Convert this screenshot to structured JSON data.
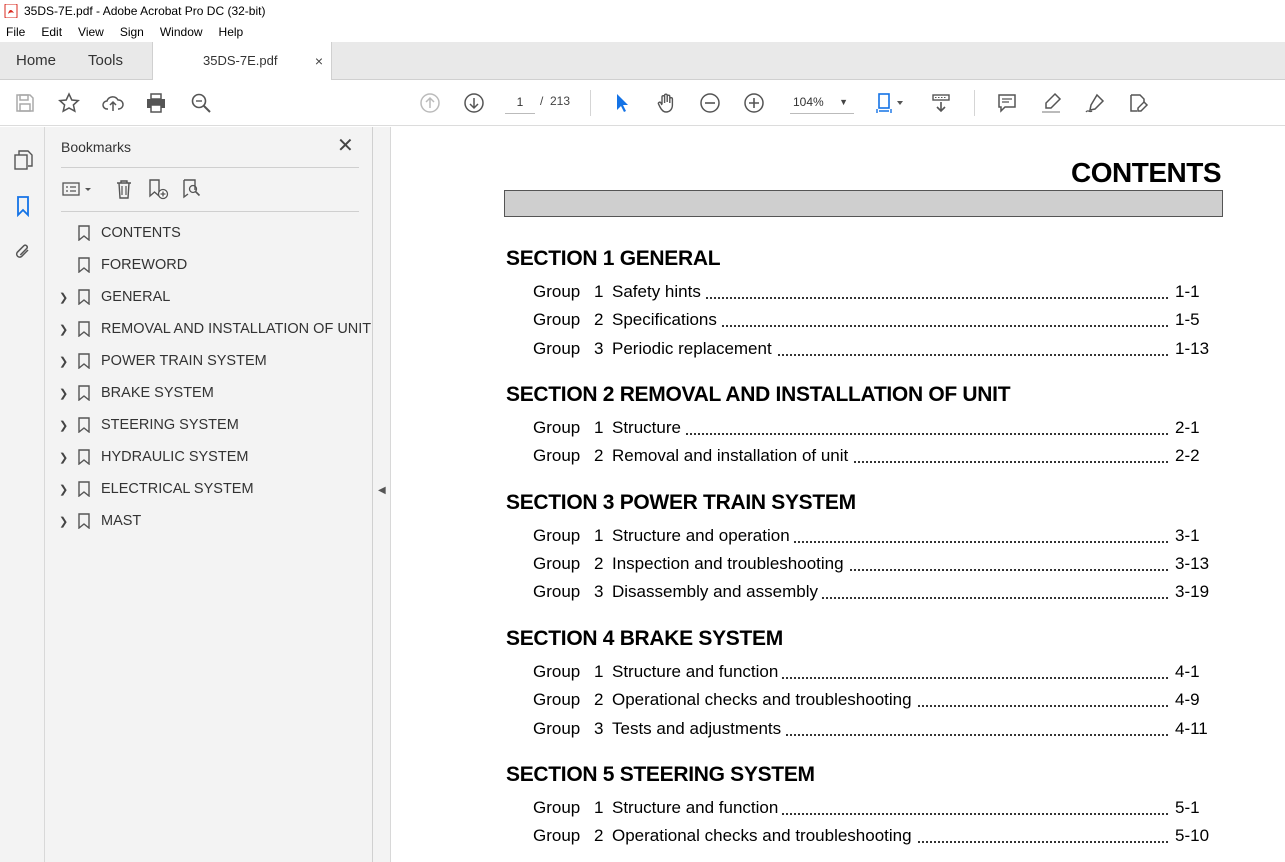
{
  "window": {
    "title": "35DS-7E.pdf - Adobe Acrobat Pro DC (32-bit)"
  },
  "menu": [
    "File",
    "Edit",
    "View",
    "Sign",
    "Window",
    "Help"
  ],
  "tabs": {
    "home": "Home",
    "tools": "Tools",
    "document": "35DS-7E.pdf",
    "close": "×"
  },
  "toolbar": {
    "page_current": "1",
    "page_separator": "/",
    "page_total": "213",
    "zoom": "104%"
  },
  "colors": {
    "accent_blue": "#1473e6",
    "icon_gray": "#555555",
    "panel_bg": "#f3f3f3",
    "pdf_icon_red": "#d9281e"
  },
  "bookmarks": {
    "title": "Bookmarks",
    "close": "✕",
    "items": [
      {
        "label": "CONTENTS",
        "expandable": false
      },
      {
        "label": "FOREWORD",
        "expandable": false
      },
      {
        "label": "GENERAL",
        "expandable": true
      },
      {
        "label": "REMOVAL AND INSTALLATION OF UNIT",
        "expandable": true
      },
      {
        "label": "POWER TRAIN SYSTEM",
        "expandable": true
      },
      {
        "label": "BRAKE SYSTEM",
        "expandable": true
      },
      {
        "label": "STEERING SYSTEM",
        "expandable": true
      },
      {
        "label": "HYDRAULIC SYSTEM",
        "expandable": true
      },
      {
        "label": "ELECTRICAL SYSTEM",
        "expandable": true
      },
      {
        "label": "MAST",
        "expandable": true
      }
    ]
  },
  "document": {
    "title": "CONTENTS",
    "sections": [
      {
        "heading": "SECTION 1  GENERAL",
        "rows": [
          {
            "group": "Group",
            "num": "1",
            "text": "Safety hints",
            "page": "1-1"
          },
          {
            "group": "Group",
            "num": "2",
            "text": "Specifications",
            "page": "1-5"
          },
          {
            "group": "Group",
            "num": "3",
            "text": "Periodic replacement",
            "page": "1-13"
          }
        ]
      },
      {
        "heading": "SECTION 2  REMOVAL AND INSTALLATION OF UNIT",
        "rows": [
          {
            "group": "Group",
            "num": "1",
            "text": "Structure",
            "page": "2-1"
          },
          {
            "group": "Group",
            "num": "2",
            "text": "Removal and installation of unit",
            "page": "2-2"
          }
        ]
      },
      {
        "heading": "SECTION 3  POWER TRAIN SYSTEM",
        "rows": [
          {
            "group": "Group",
            "num": "1",
            "text": "Structure and operation",
            "page": "3-1"
          },
          {
            "group": "Group",
            "num": "2",
            "text": "Inspection and troubleshooting",
            "page": "3-13"
          },
          {
            "group": "Group",
            "num": "3",
            "text": "Disassembly and assembly",
            "page": "3-19"
          }
        ]
      },
      {
        "heading": "SECTION 4  BRAKE SYSTEM",
        "rows": [
          {
            "group": "Group",
            "num": "1",
            "text": "Structure and function",
            "page": "4-1"
          },
          {
            "group": "Group",
            "num": "2",
            "text": "Operational checks and troubleshooting",
            "page": "4-9"
          },
          {
            "group": "Group",
            "num": "3",
            "text": "Tests and adjustments",
            "page": "4-11"
          }
        ]
      },
      {
        "heading": "SECTION 5  STEERING SYSTEM",
        "rows": [
          {
            "group": "Group",
            "num": "1",
            "text": "Structure and function",
            "page": "5-1"
          },
          {
            "group": "Group",
            "num": "2",
            "text": "Operational checks and troubleshooting",
            "page": "5-10"
          }
        ]
      }
    ]
  }
}
